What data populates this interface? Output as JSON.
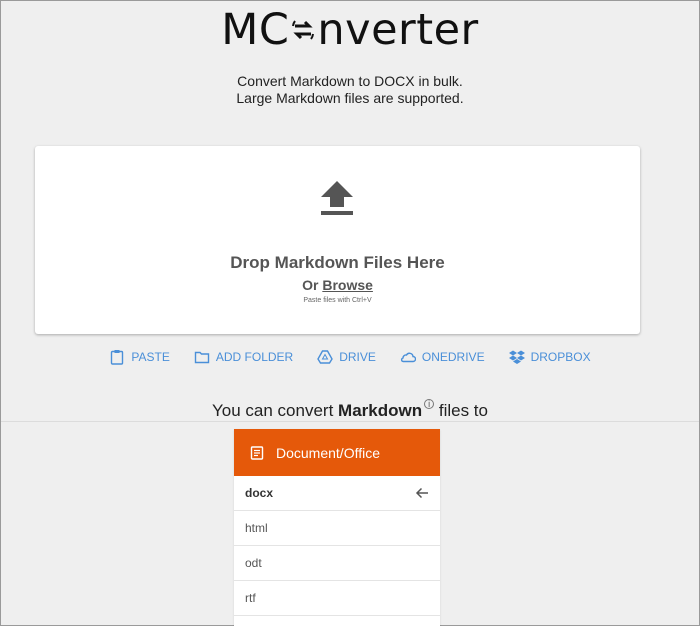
{
  "brand": {
    "logo_prefix": "MC",
    "logo_suffix": "nverter"
  },
  "tagline": {
    "line1": "Convert Markdown to DOCX in bulk.",
    "line2": "Large Markdown files are supported."
  },
  "dropzone": {
    "title": "Drop Markdown Files Here",
    "or_text": "Or",
    "browse_label": "Browse",
    "paste_hint": "Paste files with Ctrl+V"
  },
  "sources": [
    {
      "label": "PASTE",
      "icon": "clipboard-icon"
    },
    {
      "label": "ADD FOLDER",
      "icon": "folder-icon"
    },
    {
      "label": "DRIVE",
      "icon": "drive-icon"
    },
    {
      "label": "ONEDRIVE",
      "icon": "onedrive-icon"
    },
    {
      "label": "DROPBOX",
      "icon": "dropbox-icon"
    }
  ],
  "convert": {
    "prefix": "You can convert",
    "format": "Markdown",
    "suffix": "files to"
  },
  "formats": {
    "category": "Document/Office",
    "items": [
      "docx",
      "html",
      "odt",
      "rtf"
    ],
    "selected": "docx"
  },
  "colors": {
    "accent": "#e5590a",
    "link": "#4a8fd8",
    "background": "#efefef"
  }
}
